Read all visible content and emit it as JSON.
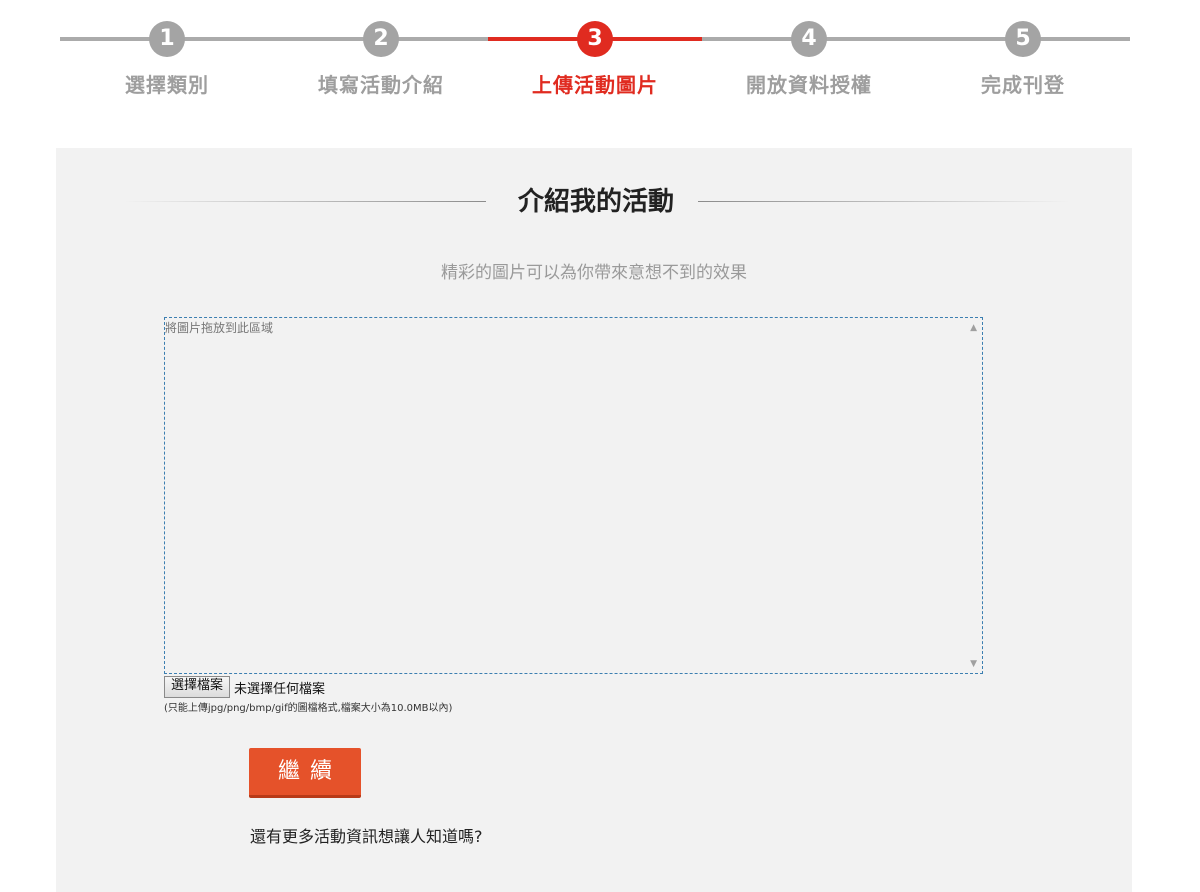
{
  "stepper": {
    "steps": [
      {
        "number": "1",
        "label": "選擇類別"
      },
      {
        "number": "2",
        "label": "填寫活動介紹"
      },
      {
        "number": "3",
        "label": "上傳活動圖片"
      },
      {
        "number": "4",
        "label": "開放資料授權"
      },
      {
        "number": "5",
        "label": "完成刊登"
      }
    ],
    "active_step": 3,
    "colors": {
      "active": "#e02b20",
      "inactive": "#a4a4a4"
    }
  },
  "section": {
    "title": "介紹我的活動",
    "subtitle": "精彩的圖片可以為你帶來意想不到的效果"
  },
  "drop_area": {
    "hint": "將圖片拖放到此區域"
  },
  "file_input": {
    "button_label": "選擇檔案",
    "status": "未選擇任何檔案",
    "note": "(只能上傳jpg/png/bmp/gif的圖檔格式,檔案大小為10.0MB以內)"
  },
  "actions": {
    "continue_label": "繼續",
    "more_info": "還有更多活動資訊想讓人知道嗎?"
  }
}
